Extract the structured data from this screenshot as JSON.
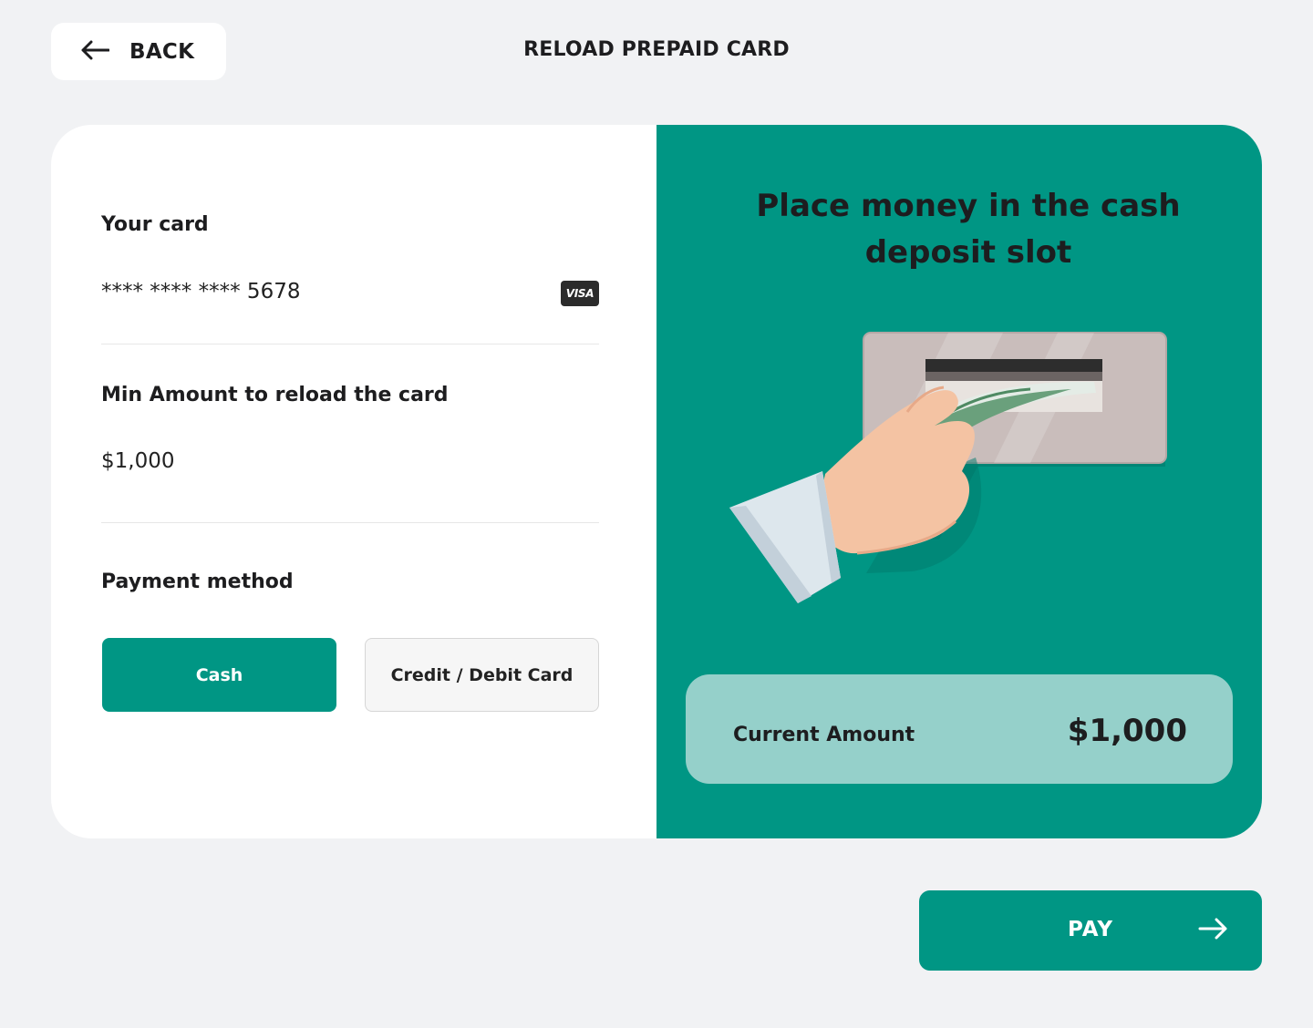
{
  "header": {
    "back_label": "BACK",
    "title": "RELOAD PREPAID CARD"
  },
  "card_section": {
    "label": "Your card",
    "number": "**** **** **** 5678",
    "brand": "VISA"
  },
  "min_amount_section": {
    "label": "Min Amount to reload the card",
    "value": "$1,000"
  },
  "payment_section": {
    "label": "Payment method",
    "options": [
      {
        "label": "Cash",
        "selected": true
      },
      {
        "label": "Credit / Debit Card",
        "selected": false
      }
    ]
  },
  "deposit": {
    "instruction_line1": "Place money in the cash",
    "instruction_line2": "deposit slot",
    "illustration_icon": "hand-inserting-cash-icon"
  },
  "current_amount": {
    "label": "Current Amount",
    "value": "$1,000"
  },
  "footer": {
    "pay_label": "PAY"
  },
  "colors": {
    "accent": "#009684",
    "accent_light": "#95d0ca",
    "background": "#f1f2f4"
  }
}
